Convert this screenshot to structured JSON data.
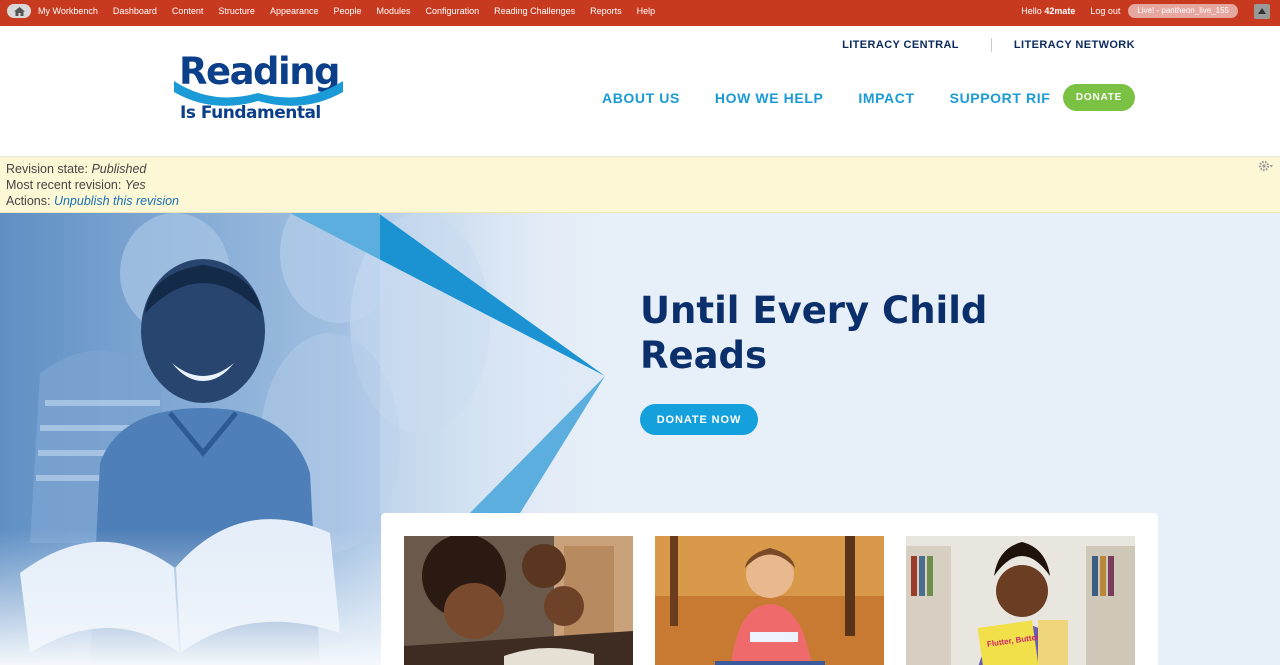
{
  "admin_bar": {
    "home_icon": "home-icon",
    "menu": [
      "My Workbench",
      "Dashboard",
      "Content",
      "Structure",
      "Appearance",
      "People",
      "Modules",
      "Configuration",
      "Reading Challenges",
      "Reports",
      "Help"
    ],
    "hello_prefix": "Hello",
    "username": "42mate",
    "logout": "Log out",
    "environment": "Live! - pantheon_live_155",
    "toggle_icon": "triangle-up-icon"
  },
  "header": {
    "logo_line1": "Reading",
    "logo_line2": "Is Fundamental",
    "util_nav": [
      "LITERACY CENTRAL",
      "LITERACY NETWORK"
    ],
    "main_nav": [
      "ABOUT US",
      "HOW WE HELP",
      "IMPACT",
      "SUPPORT RIF"
    ],
    "donate": "DONATE"
  },
  "revision": {
    "state_label": "Revision state:",
    "state_value": "Published",
    "recent_label": "Most recent revision:",
    "recent_value": "Yes",
    "actions_label": "Actions:",
    "action_link": "Unpublish this revision",
    "gear_icon": "gear-icon"
  },
  "hero": {
    "title_line1": "Until Every Child",
    "title_line2": "Reads",
    "cta": "DONATE NOW"
  },
  "cards": [
    {
      "image": "family-reading-photo"
    },
    {
      "image": "girl-with-book-autumn-photo"
    },
    {
      "image": "girl-holding-books-photo",
      "book_text": "Flutter, Butterfly!"
    }
  ],
  "colors": {
    "admin_bar": "#c83a20",
    "brand_blue": "#1a9ad6",
    "navy": "#0b2f6b",
    "donate_green": "#7bc143",
    "revision_bg": "#fcf8d6"
  }
}
